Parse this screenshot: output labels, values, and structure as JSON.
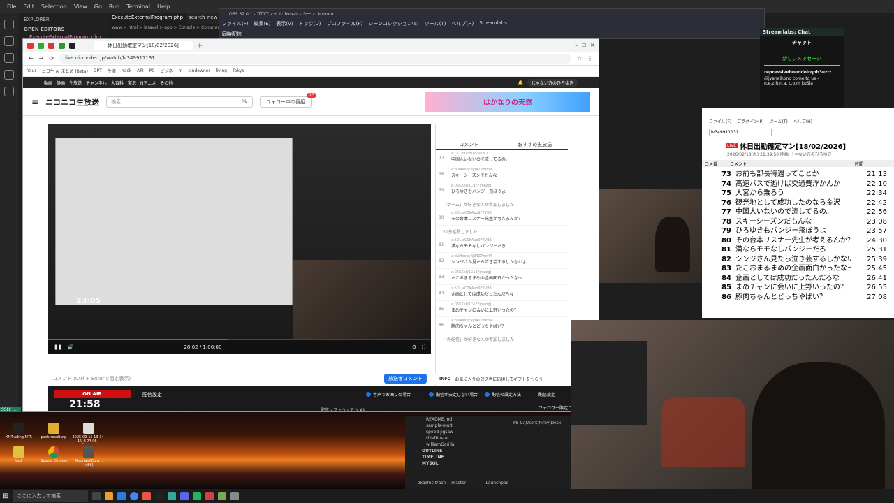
{
  "vscode": {
    "menu": [
      "File",
      "Edit",
      "Selection",
      "View",
      "Go",
      "Run",
      "Terminal",
      "Help"
    ],
    "explorer_title": "EXPLORER",
    "open_editors": "OPEN EDITORS",
    "open_file": "ExecuteExternalProgram.php",
    "tab_active": "ExecuteExternalProgram.php",
    "tab_other": "search_new",
    "breadcrumb": "www > html > laravel > app > Console > Commands",
    "lower_items": [
      "README.md",
      "sample-multi",
      "speed-jigsaw",
      "thiefBuster",
      "williamGorilla"
    ],
    "outline": "OUTLINE",
    "timeline": "TIMELINE",
    "mysql": "MYSQL",
    "terminal_path": "PS C:\\Users\\hiroy\\Desk",
    "status_branch": "master",
    "status_proj": "akashic-trash",
    "status_launchpad": "Launchpad",
    "ssh_label": "SSH: ..."
  },
  "obs": {
    "title": "OBS 32.0.1 - プロファイル: hiroshi - シーン: konnno",
    "menu": [
      "ファイル(F)",
      "編集(E)",
      "表示(V)",
      "ドック(D)",
      "プロファイル(P)",
      "シーンコレクション(S)",
      "ツール(T)",
      "ヘルプ(H)",
      "Streamlabs"
    ],
    "dock": "同時配信"
  },
  "browser": {
    "tab_title": "休日出勤確定マン[18/02/2026]",
    "url": "live.nicovideo.jp/watch/lv349911131",
    "bookmarks": [
      "Yaur",
      "ニコ生 AI まとめ (Beta)",
      "GPT",
      "生活",
      "hack",
      "API",
      "PC",
      "ビジネ",
      "m",
      "landowner",
      "living",
      "Tokyo"
    ]
  },
  "nico": {
    "topbar": [
      "動画",
      "静画",
      "生放送",
      "チャンネル",
      "大百科",
      "実況",
      "Nアニメ",
      "その他"
    ],
    "user": "じゃない方のひろゆき",
    "logo": "ニコニコ生放送",
    "search_placeholder": "検索",
    "follow_label": "フォロー中の番組",
    "follow_count": "23",
    "ad_text": "はかなりの天然",
    "player_time": "28:02 / 1:00:00",
    "comment_tabs": [
      "コメント",
      "おすすめ生放送"
    ],
    "comment_placeholder": "コメント (Ctrl + Enterで固定表示)",
    "bcast_btn": "放送者コメント",
    "info_label": "INFO",
    "info_text": "お気に入りの放送者に応援してギフトをもらう",
    "onair": "ON AIR",
    "onair_time": "21:58",
    "setting_label": "配信設定",
    "opts": [
      "音声でお困りの場合",
      "配信が安定しない場合",
      "配信の設定方法"
    ],
    "side_setting": "配信設定",
    "side_follow": "フォロワー限定コメント",
    "software_label": "配信ソフトウェア N Air"
  },
  "comments": [
    {
      "no": "77",
      "id": "a:_5_2fYi7hUkyRRm1",
      "text": "中国人いないので流してるの。"
    },
    {
      "no": "78",
      "id": "a:dul4exqcRj34Z7mnfR",
      "text": "スキーシーズンでもんな"
    },
    {
      "no": "79",
      "id": "a:05KXeQ1CuEFjmnzgJ",
      "text": "ひろゆきもバンジー飛ぼうよ"
    },
    {
      "sys": "「ゲーム」が好きな人が参加しました"
    },
    {
      "no": "80",
      "id": "a:5DLieC0KAuo9F7VB3",
      "text": "その台本リスナー先生が考えるんか？"
    },
    {
      "sys": "30分延長しました"
    },
    {
      "no": "81",
      "id": "a:5DLieC0KAuo9F7VB3",
      "text": "漢ならモモなしバンジーだろ"
    },
    {
      "no": "82",
      "id": "a:dul4exqcRj34Z7mnfR",
      "text": "シンジさん見たら泣き芸するしかないよ"
    },
    {
      "no": "83",
      "id": "a:05KXeQ1CuEFjmnzgJ",
      "text": "たこおまるまめの企画面白かったな～"
    },
    {
      "no": "84",
      "id": "a:5DLieC0KAuo9F7VB3",
      "text": "企画としては成功だったんだろな"
    },
    {
      "no": "85",
      "id": "a:05KXeQ1CuEFjmnzgJ",
      "text": "まめチャンに会いに上野いったの？"
    },
    {
      "no": "86",
      "id": "a:dul4exqcRj34Z7mnfR",
      "text": "豚肉ちゃんとどっちやばい？"
    },
    {
      "sys": "「外配信」が好きな人が参加しました"
    }
  ],
  "streamlabs": {
    "title": "Streamlabs: Chat",
    "chat": "チャット",
    "new_msg": "新しいメッセージ",
    "user": "repressivebouddoirqpb3ezc:",
    "msg": "@jyanaihono come to us - n.e.z.h.n.a. c.o.m kuSla"
  },
  "hirotool": {
    "menu": [
      "ファイル(F)",
      "プラグイン(P)",
      "ツール(T)",
      "ヘルプ(H)"
    ],
    "lv": "lv349911131",
    "live_badge": "LIVE",
    "title": "休日出勤確定マン[18/02/2026]",
    "sub": "2026/02/18(水) 21:39:50 開始  じゃない方のひろゆき",
    "col_no": "コメ番",
    "col_comment": "コメント",
    "col_time": "時間",
    "rows": [
      {
        "n": "73",
        "t": "お前も部長待遇ってことか",
        "tm": "21:13"
      },
      {
        "n": "74",
        "t": "高速バスで逝けば交通費浮かんか",
        "tm": "22:10"
      },
      {
        "n": "75",
        "t": "大宮から乗ろう",
        "tm": "22:34"
      },
      {
        "n": "76",
        "t": "観光地として成功したのなら金沢",
        "tm": "22:42"
      },
      {
        "n": "77",
        "t": "中国人いないので流してるの。",
        "tm": "22:56"
      },
      {
        "n": "78",
        "t": "スキーシーズンだもんな",
        "tm": "23:08"
      },
      {
        "n": "79",
        "t": "ひろゆきもバンジー飛ぼうよ",
        "tm": "23:57"
      },
      {
        "n": "80",
        "t": "その台本リスナー先生が考えるんか？",
        "tm": "24:30"
      },
      {
        "n": "81",
        "t": "漢ならモモなしバンジーだろ",
        "tm": "25:31"
      },
      {
        "n": "82",
        "t": "シンジさん見たら泣き芸するしかないよ",
        "tm": "25:39"
      },
      {
        "n": "83",
        "t": "たこおまるまめの企画面白かったな～",
        "tm": "25:45"
      },
      {
        "n": "84",
        "t": "企画としては成功だったんだろな",
        "tm": "26:41"
      },
      {
        "n": "85",
        "t": "まめチャンに会いに上野いったの？",
        "tm": "26:55"
      },
      {
        "n": "86",
        "t": "豚肉ちゃんとどっちやばい？",
        "tm": "27:08"
      }
    ]
  },
  "desktop": {
    "icons": [
      "XMTrading MT5",
      "pack-result.zip",
      "2025-09-15 13-34-45_8.23.06...",
      "test",
      "Google Chrome",
      "NiconamiCom... (x86)"
    ]
  },
  "taskbar": {
    "search": "ここに入力して検索"
  },
  "colors": {
    "accent": "#1a73e8",
    "onair": "#d01010",
    "live": "#e02020"
  }
}
